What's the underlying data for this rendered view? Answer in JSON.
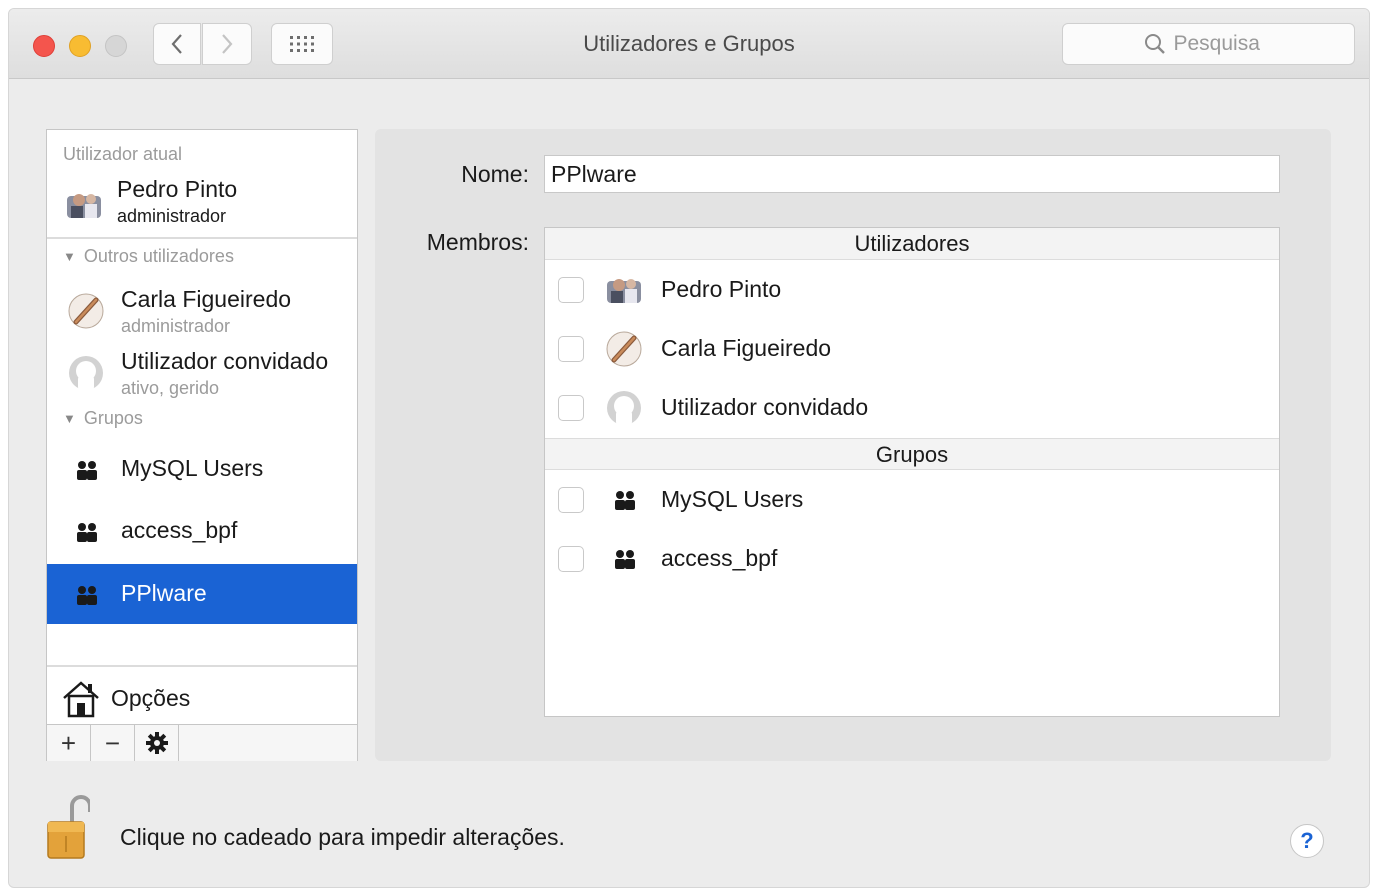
{
  "window": {
    "title": "Utilizadores e Grupos"
  },
  "search": {
    "placeholder": "Pesquisa"
  },
  "sidebar": {
    "current_header": "Utilizador atual",
    "current_user": {
      "name": "Pedro  Pinto",
      "role": "administrador"
    },
    "others_header": "Outros utilizadores",
    "others": [
      {
        "name": "Carla Figueiredo",
        "role": "administrador"
      },
      {
        "name": "Utilizador convidado",
        "role": "ativo, gerido"
      }
    ],
    "groups_header": "Grupos",
    "groups": [
      {
        "name": "MySQL Users",
        "selected": false
      },
      {
        "name": "access_bpf",
        "selected": false
      },
      {
        "name": "PPlware",
        "selected": true
      }
    ],
    "options_label": "Opções",
    "toolbar": {
      "add": "+",
      "remove": "−"
    }
  },
  "detail": {
    "name_label": "Nome:",
    "name_value": "PPlware",
    "members_label": "Membros:",
    "users_header": "Utilizadores",
    "users": [
      {
        "name": "Pedro  Pinto",
        "checked": false
      },
      {
        "name": "Carla Figueiredo",
        "checked": false
      },
      {
        "name": "Utilizador convidado",
        "checked": false
      }
    ],
    "groups_header": "Grupos",
    "groups": [
      {
        "name": "MySQL Users",
        "checked": false
      },
      {
        "name": "access_bpf",
        "checked": false
      }
    ]
  },
  "footer": {
    "lock_text": "Clique no cadeado para impedir alterações.",
    "help_label": "?"
  },
  "colors": {
    "selection": "#1a63d4",
    "panel": "#e3e3e3",
    "window": "#ececec"
  }
}
